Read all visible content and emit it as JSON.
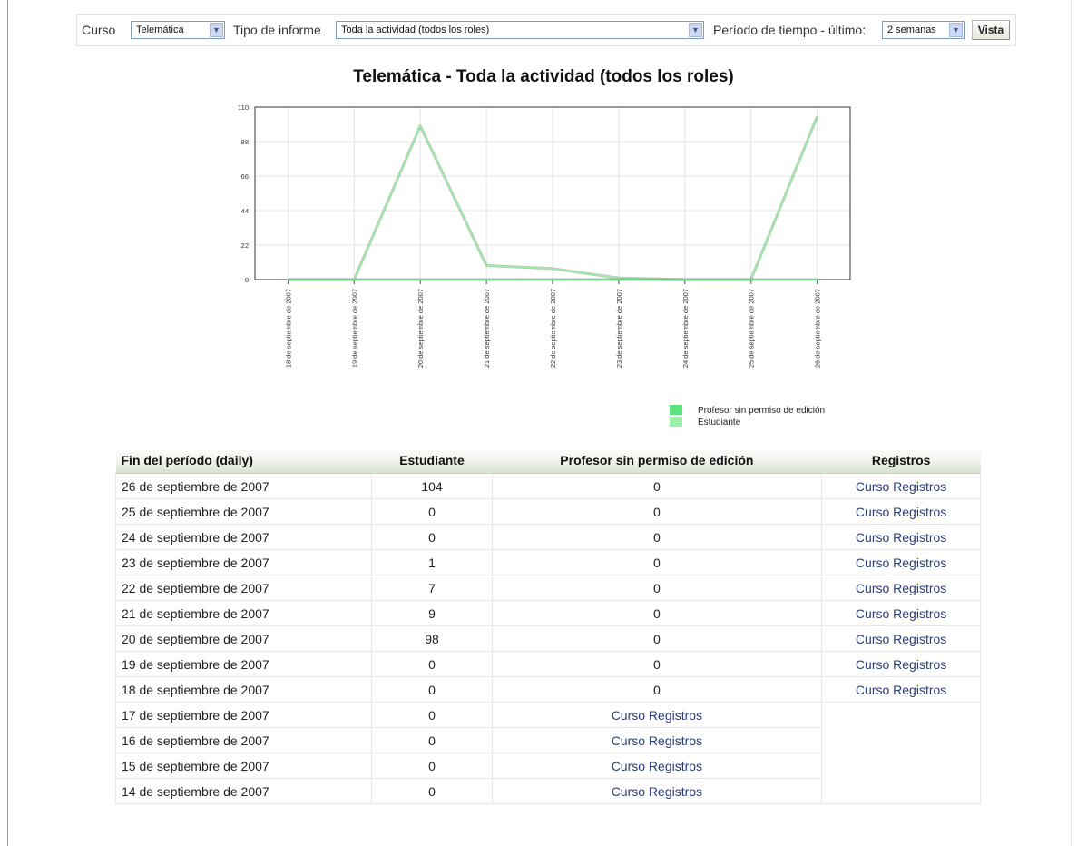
{
  "filters": {
    "course_label": "Curso",
    "course_value": "Telemática",
    "report_label": "Tipo de informe",
    "report_value": "Toda la actividad (todos los roles)",
    "period_label": "Período de tiempo - último:",
    "period_value": "2 semanas",
    "view_button": "Vista"
  },
  "chart_data": {
    "type": "line",
    "title": "Telemática - Toda la actividad (todos los roles)",
    "xlabel": "",
    "ylabel": "",
    "categories": [
      "18 de septiembre de 2007",
      "19 de septiembre de 2007",
      "20 de septiembre de 2007",
      "21 de septiembre de 2007",
      "22 de septiembre de 2007",
      "23 de septiembre de 2007",
      "24 de septiembre de 2007",
      "25 de septiembre de 2007",
      "26 de septiembre de 2007"
    ],
    "series": [
      {
        "name": "Profesor sin permiso de edición",
        "values": [
          0,
          0,
          0,
          0,
          0,
          0,
          0,
          0,
          0
        ],
        "color": "#5ce27e"
      },
      {
        "name": "Estudiante",
        "values": [
          0,
          0,
          98,
          9,
          7,
          1,
          0,
          0,
          104
        ],
        "color": "#9af0a4"
      }
    ],
    "ylim": [
      0,
      110
    ],
    "yticks": [
      "0",
      "22",
      "44",
      "66",
      "88",
      "110"
    ],
    "grid": true,
    "legend_position": "bottom-right"
  },
  "table": {
    "headers": [
      "Fin del período (daily)",
      "Estudiante",
      "Profesor sin permiso de edición",
      "Registros"
    ],
    "rows": [
      {
        "date": "26 de septiembre de 2007",
        "estudiante": "104",
        "profesor": "0",
        "registros": "Curso Registros"
      },
      {
        "date": "25 de septiembre de 2007",
        "estudiante": "0",
        "profesor": "0",
        "registros": "Curso Registros"
      },
      {
        "date": "24 de septiembre de 2007",
        "estudiante": "0",
        "profesor": "0",
        "registros": "Curso Registros"
      },
      {
        "date": "23 de septiembre de 2007",
        "estudiante": "1",
        "profesor": "0",
        "registros": "Curso Registros"
      },
      {
        "date": "22 de septiembre de 2007",
        "estudiante": "7",
        "profesor": "0",
        "registros": "Curso Registros"
      },
      {
        "date": "21 de septiembre de 2007",
        "estudiante": "9",
        "profesor": "0",
        "registros": "Curso Registros"
      },
      {
        "date": "20 de septiembre de 2007",
        "estudiante": "98",
        "profesor": "0",
        "registros": "Curso Registros"
      },
      {
        "date": "19 de septiembre de 2007",
        "estudiante": "0",
        "profesor": "0",
        "registros": "Curso Registros"
      },
      {
        "date": "18 de septiembre de 2007",
        "estudiante": "0",
        "profesor": "0",
        "registros": "Curso Registros"
      },
      {
        "date": "17 de septiembre de 2007",
        "estudiante": "0",
        "profesor": "Curso Registros",
        "registros": ""
      },
      {
        "date": "16 de septiembre de 2007",
        "estudiante": "0",
        "profesor": "Curso Registros",
        "registros": ""
      },
      {
        "date": "15 de septiembre de 2007",
        "estudiante": "0",
        "profesor": "Curso Registros",
        "registros": ""
      },
      {
        "date": "14 de septiembre de 2007",
        "estudiante": "0",
        "profesor": "Curso Registros",
        "registros": ""
      }
    ]
  }
}
